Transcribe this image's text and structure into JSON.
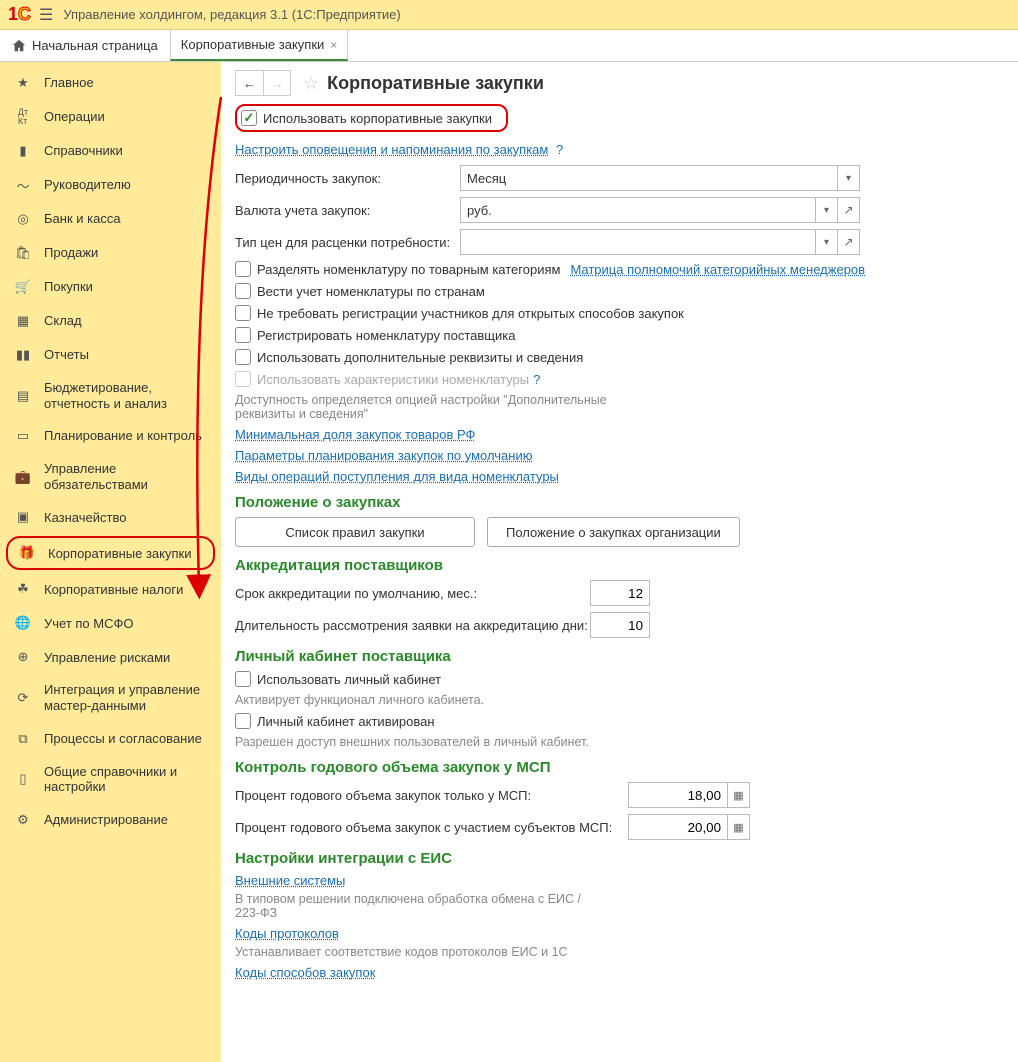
{
  "app": {
    "title": "Управление холдингом, редакция 3.1  (1С:Предприятие)"
  },
  "tabs": {
    "home": "Начальная страница",
    "active": "Корпоративные закупки"
  },
  "sidebar": {
    "items": [
      {
        "label": "Главное"
      },
      {
        "label": "Операции"
      },
      {
        "label": "Справочники"
      },
      {
        "label": "Руководителю"
      },
      {
        "label": "Банк и касса"
      },
      {
        "label": "Продажи"
      },
      {
        "label": "Покупки"
      },
      {
        "label": "Склад"
      },
      {
        "label": "Отчеты"
      },
      {
        "label": "Бюджетирование, отчетность и анализ"
      },
      {
        "label": "Планирование и контроль"
      },
      {
        "label": "Управление обязательствами"
      },
      {
        "label": "Казначейство"
      },
      {
        "label": "Корпоративные закупки"
      },
      {
        "label": "Корпоративные налоги"
      },
      {
        "label": "Учет по МСФО"
      },
      {
        "label": "Управление рисками"
      },
      {
        "label": "Интеграция и управление мастер-данными"
      },
      {
        "label": "Процессы и согласование"
      },
      {
        "label": "Общие справочники и настройки"
      },
      {
        "label": "Администрирование"
      }
    ]
  },
  "page": {
    "title": "Корпоративные закупки",
    "use_corp_label": "Использовать корпоративные закупки",
    "notify_link": "Настроить оповещения и напоминания по закупкам",
    "period_label": "Периодичность закупок:",
    "period_value": "Месяц",
    "currency_label": "Валюта учета закупок:",
    "currency_value": "руб.",
    "price_type_label": "Тип цен для расценки потребности:",
    "price_type_value": "",
    "chk_categories": "Разделять номенклатуру по товарным категориям",
    "link_matrix": "Матрица полномочий категорийных менеджеров",
    "chk_countries": "Вести учет номенклатуры по странам",
    "chk_noreg": "Не требовать регистрации участников для открытых способов закупок",
    "chk_reg_supplier": "Регистрировать номенклатуру поставщика",
    "chk_extra_props": "Использовать дополнительные реквизиты и сведения",
    "chk_characteristics": "Использовать характеристики номенклатуры",
    "availability_hint": "Доступность определяется опцией настройки \"Дополнительные реквизиты и сведения\"",
    "link_min_share": "Минимальная доля закупок товаров РФ",
    "link_params": "Параметры планирования закупок по умолчанию",
    "link_op_types": "Виды операций поступления для вида номенклатуры",
    "section_rules": "Положение о закупках",
    "btn_rules_list": "Список правил закупки",
    "btn_rules_org": "Положение о закупках организации",
    "section_accred": "Аккредитация поставщиков",
    "accred_term_label": "Срок аккредитации по умолчанию, мес.:",
    "accred_term_value": "12",
    "accred_review_label": "Длительность рассмотрения заявки на аккредитацию дни:",
    "accred_review_value": "10",
    "section_cabinet": "Личный кабинет поставщика",
    "chk_use_cabinet": "Использовать личный кабинет",
    "hint_cabinet": "Активирует функционал личного кабинета.",
    "chk_cabinet_active": "Личный кабинет активирован",
    "hint_cabinet_active": "Разрешен доступ внешних пользователей в личный кабинет.",
    "section_msp": "Контроль годового объема закупок у МСП",
    "msp_only_label": "Процент годового объема закупок только у МСП:",
    "msp_only_value": "18,00",
    "msp_with_label": "Процент годового объема закупок с участием субъектов МСП:",
    "msp_with_value": "20,00",
    "section_eis": "Настройки интеграции с ЕИС",
    "link_ext_systems": "Внешние системы",
    "hint_ext_systems": "В типовом решении подключена обработка обмена с ЕИС / 223-ФЗ",
    "link_proto_codes": "Коды протоколов",
    "hint_proto_codes": "Устанавливает соответствие кодов протоколов ЕИС и 1С",
    "link_method_codes": "Коды способов закупок"
  }
}
